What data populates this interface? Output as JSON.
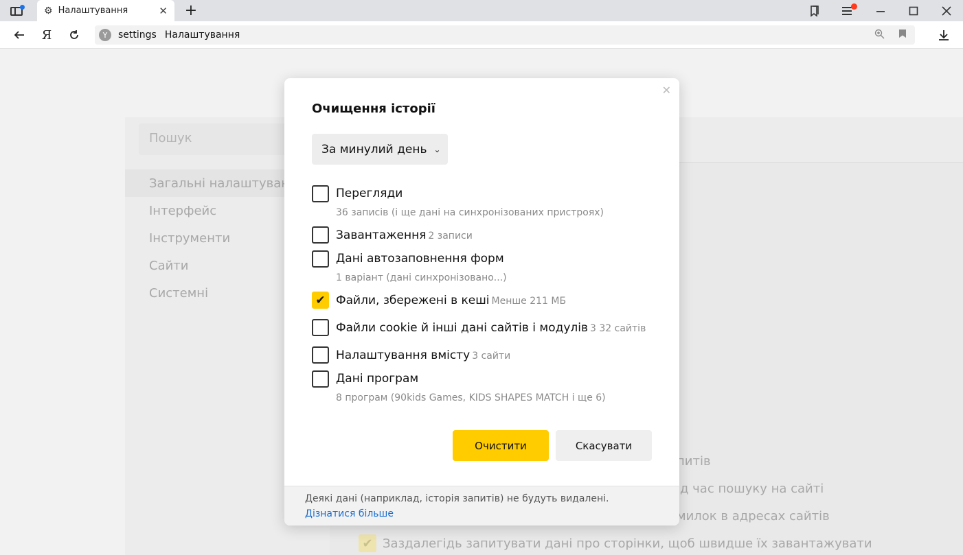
{
  "browser": {
    "tab_title": "Налаштування",
    "new_tab_icon": "+",
    "close_tab_icon": "✕",
    "ya_label": "Я",
    "omnibox": {
      "url": "settings",
      "page_title": "Налаштування"
    }
  },
  "settings_page": {
    "search_placeholder": "Пошук",
    "nav": [
      {
        "label": "Загальні налаштування"
      },
      {
        "label": "Інтерфейс"
      },
      {
        "label": "Інструменти"
      },
      {
        "label": "Сайти"
      },
      {
        "label": "Системні"
      }
    ],
    "background_lines": [
      "питів",
      "ід час пошуку на сайті",
      "милок в адресах сайтів",
      "Заздалегідь запитувати дані про сторінки, щоб швидше їх завантажувати"
    ]
  },
  "dialog": {
    "title": "Очищення історії",
    "period": "За минулий день",
    "options": [
      {
        "label": "Перегляди",
        "note": "",
        "desc": "36 записів (і ще дані на синхронізованих пристроях)",
        "checked": false
      },
      {
        "label": "Завантаження",
        "note": "2 записи",
        "desc": "",
        "checked": false
      },
      {
        "label": "Дані автозаповнення форм",
        "note": "",
        "desc": "1 варіант (дані синхронізовано...)",
        "checked": false
      },
      {
        "label": "Файли, збережені в кеші",
        "note": "Менше 211 МБ",
        "desc": "",
        "checked": true
      },
      {
        "label": "Файли cookie й інші дані сайтів і модулів",
        "note": "3 32 сайтів",
        "desc": "",
        "checked": false
      },
      {
        "label": "Налаштування вмісту",
        "note": "3 сайти",
        "desc": "",
        "checked": false
      },
      {
        "label": "Дані програм",
        "note": "",
        "desc": "8 програм (90kids Games, KIDS SHAPES MATCH і ще 6)",
        "checked": false
      }
    ],
    "clear_button": "Очистити",
    "cancel_button": "Скасувати",
    "footer_note": "Деякі дані (наприклад, історія запитів) не будуть видалені.",
    "footer_link": "Дізнатися більше"
  },
  "colors": {
    "accent": "#ffcc00",
    "link": "#1a6fd1",
    "notification_dot": "#ff3b1f"
  }
}
